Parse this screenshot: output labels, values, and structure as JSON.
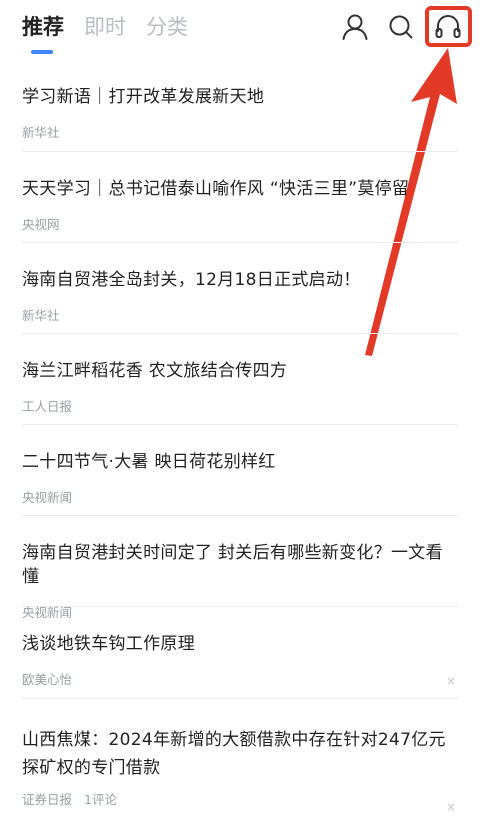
{
  "tabs": [
    {
      "label": "推荐",
      "active": true
    },
    {
      "label": "即时",
      "active": false
    },
    {
      "label": "分类",
      "active": false
    }
  ],
  "header_icons": [
    "user-icon",
    "search-icon",
    "headphones-icon"
  ],
  "accent_color": "#3d86f5",
  "annotation_color": "#e23a27",
  "close_glyph": "×",
  "feed": [
    {
      "title": "学习新语｜打开改革发展新天地",
      "source": "新华社"
    },
    {
      "title": "天天学习｜总书记借泰山喻作风 “快活三里”莫停留",
      "source": "央视网"
    },
    {
      "title": "海南自贸港全岛封关，12月18日正式启动！",
      "source": "新华社"
    },
    {
      "title": "海兰江畔稻花香 农文旅结合传四方",
      "source": "工人日报"
    },
    {
      "title": "二十四节气·大暑 映日荷花别样红",
      "source": "央视新闻"
    },
    {
      "title": "海南自贸港封关时间定了 封关后有哪些新变化？一文看懂",
      "source": "央视新闻"
    },
    {
      "title": "浅谈地铁车钩工作原理",
      "source": "欧美心怡"
    },
    {
      "title": "山西焦煤：2024年新增的大额借款中存在针对247亿元探矿权的专门借款",
      "source": "证券日报",
      "comments": "1评论"
    }
  ]
}
